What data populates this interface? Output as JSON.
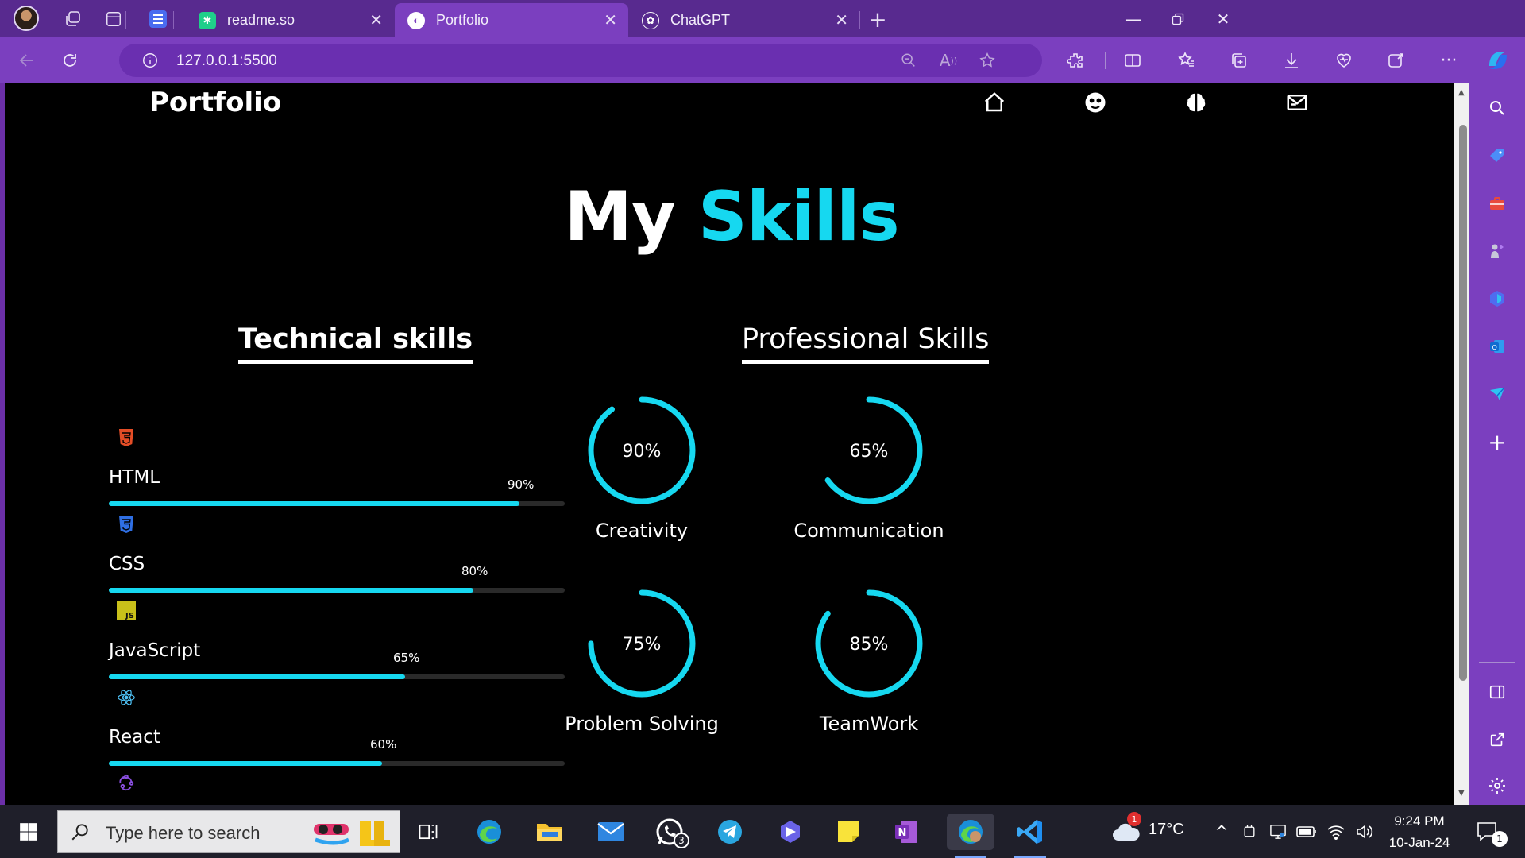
{
  "browser": {
    "tabs": [
      {
        "title": "readme.so",
        "active": false
      },
      {
        "title": "Portfolio",
        "active": true
      },
      {
        "title": "ChatGPT",
        "active": false
      }
    ],
    "url": "127.0.0.1:5500"
  },
  "site": {
    "brand": "Portfolio",
    "nav_icons": [
      "home-icon",
      "face-icon",
      "brain-icon",
      "mail-icon"
    ],
    "heading_plain": "My",
    "heading_accent": "Skills",
    "accent_color": "#16d8f0",
    "technical_title": "Technical skills",
    "professional_title": "Professional Skills",
    "technical_skills": [
      {
        "name": "HTML",
        "percent_label": "90%",
        "level": 90,
        "icon": "html5-icon",
        "icon_color": "#e44d26"
      },
      {
        "name": "CSS",
        "percent_label": "80%",
        "level": 80,
        "icon": "css3-icon",
        "icon_color": "#2f6fe4"
      },
      {
        "name": "JavaScript",
        "percent_label": "65%",
        "level": 65,
        "icon": "javascript-icon",
        "icon_color": "#c9c01a"
      },
      {
        "name": "React",
        "percent_label": "60%",
        "level": 60,
        "icon": "react-icon",
        "icon_color": "#4fc3f7"
      }
    ],
    "next_icon": {
      "icon": "redux-icon",
      "icon_color": "#8a4fe0"
    },
    "professional_skills": [
      {
        "name": "Creativity",
        "percent_label": "90%",
        "level": 90
      },
      {
        "name": "Communication",
        "percent_label": "65%",
        "level": 65
      },
      {
        "name": "Problem Solving",
        "percent_label": "75%",
        "level": 75
      },
      {
        "name": "TeamWork",
        "percent_label": "85%",
        "level": 85
      }
    ]
  },
  "taskbar": {
    "search_placeholder": "Type here to search",
    "whatsapp_badge": "3",
    "weather": "17°C",
    "weather_badge": "1",
    "time": "9:24 PM",
    "date": "10-Jan-24",
    "notification_count": "1"
  }
}
